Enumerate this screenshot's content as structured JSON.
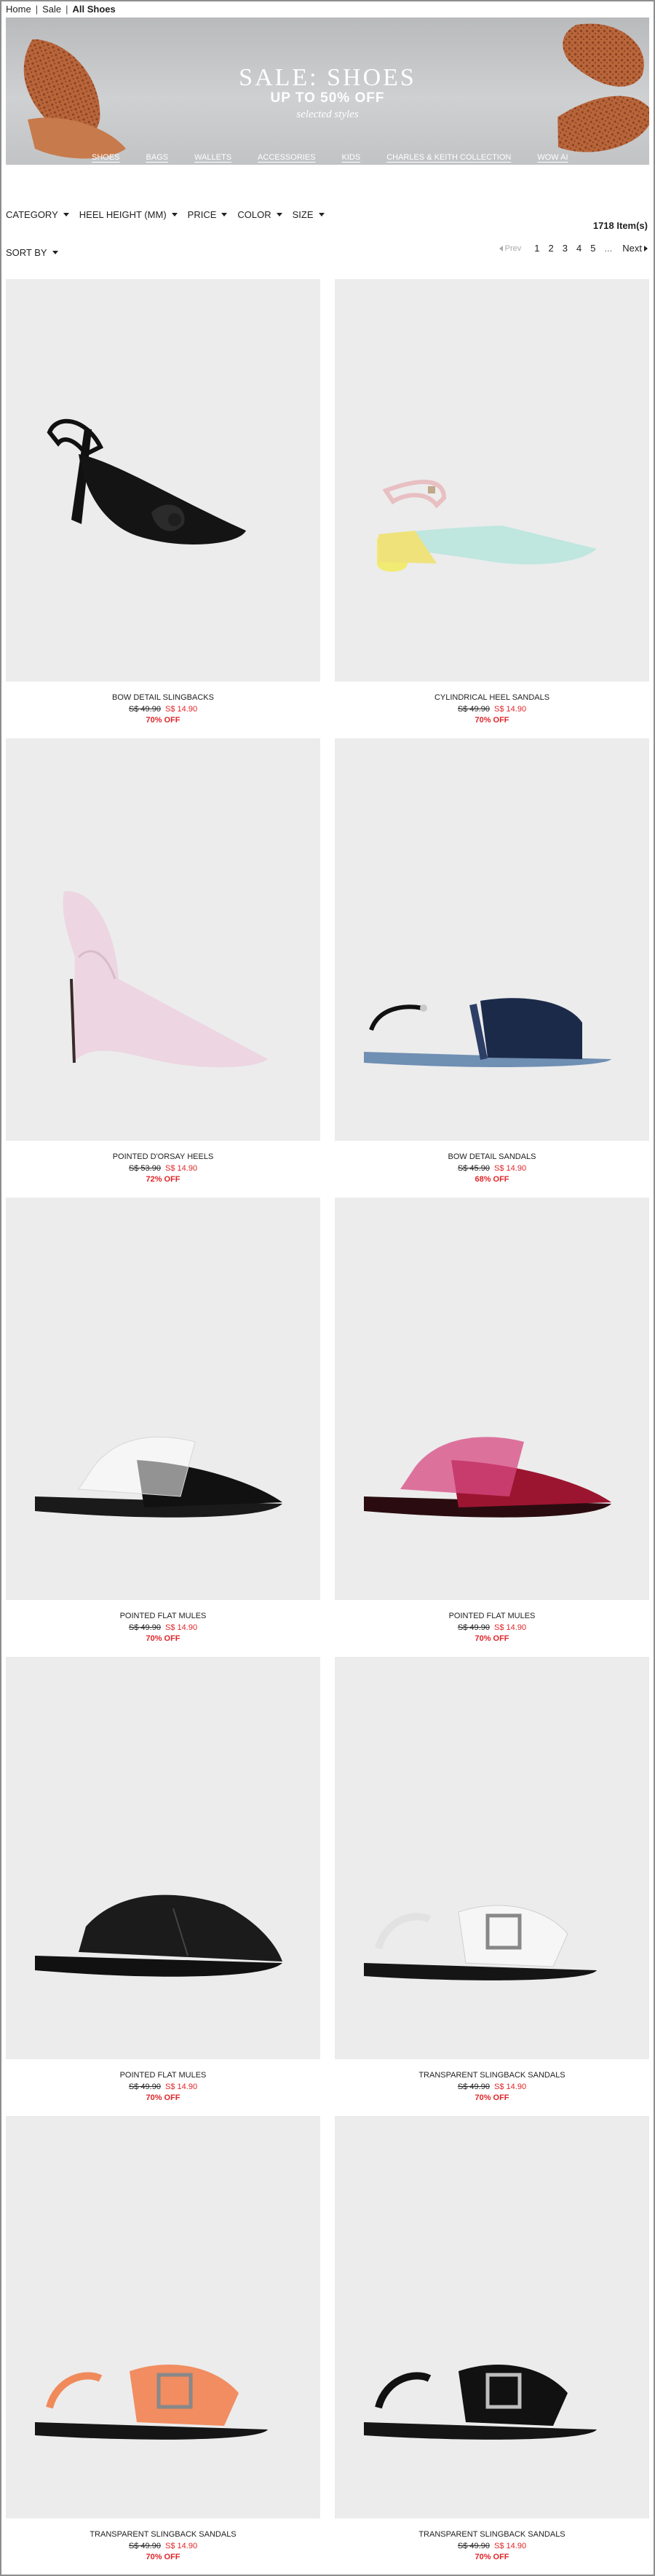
{
  "breadcrumb": {
    "home": "Home",
    "sale": "Sale",
    "current": "All Shoes"
  },
  "hero": {
    "title": "SALE: SHOES",
    "subtitle": "UP TO 50% OFF",
    "note": "selected styles",
    "nav": [
      "SHOES",
      "BAGS",
      "WALLETS",
      "ACCESSORIES",
      "KIDS",
      "CHARLES & KEITH COLLECTION",
      "WOW AI"
    ]
  },
  "filters": {
    "category": "CATEGORY",
    "heel_height": "HEEL HEIGHT (MM)",
    "price": "PRICE",
    "color": "COLOR",
    "size": "SIZE",
    "sort_by": "SORT BY"
  },
  "results": {
    "count": "1718 Item(s)"
  },
  "pagination": {
    "prev": "Prev",
    "pages": [
      "1",
      "2",
      "3",
      "4",
      "5"
    ],
    "ellipsis": "...",
    "next": "Next"
  },
  "products": [
    {
      "name": "BOW DETAIL SLINGBACKS",
      "was": "S$ 49.90",
      "now": "S$ 14.90",
      "off": "70% OFF"
    },
    {
      "name": "CYLINDRICAL HEEL SANDALS",
      "was": "S$ 49.90",
      "now": "S$ 14.90",
      "off": "70% OFF"
    },
    {
      "name": "POINTED D'ORSAY HEELS",
      "was": "S$ 53.90",
      "now": "S$ 14.90",
      "off": "72% OFF"
    },
    {
      "name": "BOW DETAIL SANDALS",
      "was": "S$ 45.90",
      "now": "S$ 14.90",
      "off": "68% OFF"
    },
    {
      "name": "POINTED FLAT MULES",
      "was": "S$ 49.90",
      "now": "S$ 14.90",
      "off": "70% OFF"
    },
    {
      "name": "POINTED FLAT MULES",
      "was": "S$ 49.90",
      "now": "S$ 14.90",
      "off": "70% OFF"
    },
    {
      "name": "POINTED FLAT MULES",
      "was": "S$ 49.90",
      "now": "S$ 14.90",
      "off": "70% OFF"
    },
    {
      "name": "TRANSPARENT SLINGBACK SANDALS",
      "was": "S$ 49.90",
      "now": "S$ 14.90",
      "off": "70% OFF"
    },
    {
      "name": "TRANSPARENT SLINGBACK SANDALS",
      "was": "S$ 49.90",
      "now": "S$ 14.90",
      "off": "70% OFF"
    },
    {
      "name": "TRANSPARENT SLINGBACK SANDALS",
      "was": "S$ 49.90",
      "now": "S$ 14.90",
      "off": "70% OFF"
    }
  ],
  "colors": {
    "sale_red": "#e0262a",
    "tile_bg": "#ececec",
    "banner_grey": "#c6c7c9"
  }
}
